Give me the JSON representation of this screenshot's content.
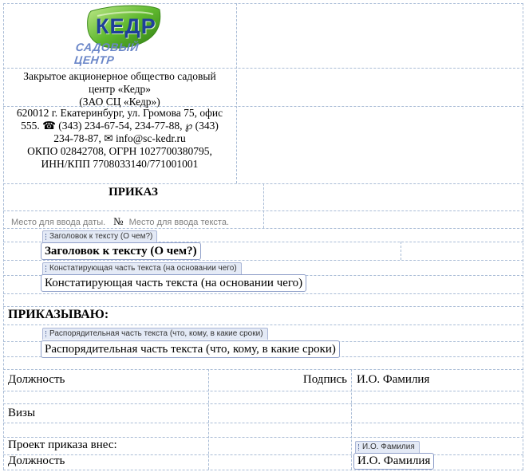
{
  "company": {
    "logo_text": "КЕДР",
    "logo_subtext": "САДОВЫЙ ЦЕНТР",
    "name_line1": "Закрытое акционерное общество садовый",
    "name_line2": "центр «Кедр»",
    "name_short": "(ЗАО СЦ «Кедр»)",
    "address_line1": "620012 г. Екатеринбург, ул. Громова 75, офис",
    "address_line2": "555. ☎ (343) 234-67-54, 234-77-88, ℘ (343)",
    "address_line3": "234-78-87, ✉ info@sc-kedr.ru",
    "address_line4": "ОКПО 02842708, ОГРН 1027700380795,",
    "address_line5": "ИНН/КПП 7708033140/771001001"
  },
  "order": {
    "title": "ПРИКАЗ",
    "date_placeholder": "Место для ввода даты.",
    "number_sign": "№",
    "number_placeholder": "Место для ввода текста."
  },
  "fields": {
    "heading_tag": "Заголовок к тексту (О чем?)",
    "heading_value": "Заголовок к тексту (О чем?)",
    "statement_tag": "Констатирующая часть текста (на основании чего)",
    "statement_value": "Констатирующая часть текста (на основании чего)",
    "order_word": "ПРИКАЗЫВАЮ:",
    "directive_tag": "Распорядительная часть текста (что, кому, в какие сроки)",
    "directive_value": "Распорядительная часть текста (что, кому, в какие сроки)"
  },
  "signature": {
    "position_label": "Должность",
    "sign_label": "Подпись",
    "name": "И.О. Фамилия",
    "visas_label": "Визы",
    "draft_label": "Проект приказа внес:",
    "draft_position": "Должность",
    "draft_name_tag": "И.О. Фамилия",
    "draft_name_value": "И.О. Фамилия"
  },
  "colors": {
    "logo_green": "#5fb82e",
    "logo_text_blue": "#1e3f9a",
    "gridline": "#a9bcd6"
  }
}
